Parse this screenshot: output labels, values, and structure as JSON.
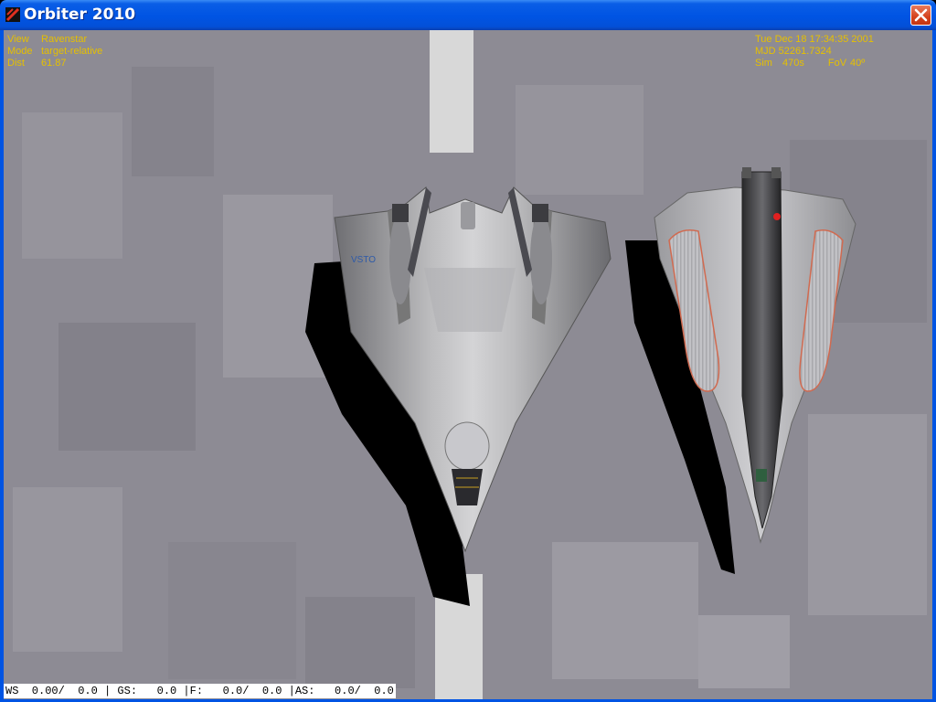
{
  "window": {
    "title": "Orbiter 2010",
    "icons": {
      "app": "orbiter-app-icon",
      "close": "close-icon"
    }
  },
  "hud": {
    "view_label": "View",
    "view_value": "Ravenstar",
    "mode_label": "Mode",
    "mode_value": "target-relative",
    "dist_label": "Dist",
    "dist_value": "61.87",
    "date": "Tue Dec 18 17:34:35 2001",
    "mjd": "MJD 52261.7324",
    "sim_label": "Sim",
    "sim_value": "470s",
    "fov_label": "FoV",
    "fov_value": "40º",
    "color": "#e6c000"
  },
  "status_bar": {
    "text": "WS  0.00/  0.0 | GS:   0.0 |F:   0.0/  0.0 |AS:   0.0/  0.0"
  },
  "scene": {
    "ground_color": "#8d8b94",
    "runway_color": "#d8d8d8",
    "left_vehicle": "ravenstar-spaceplane",
    "right_vehicle": "second-spaceplane",
    "decal_text": "VSTO",
    "marker_color": "#e02020"
  }
}
